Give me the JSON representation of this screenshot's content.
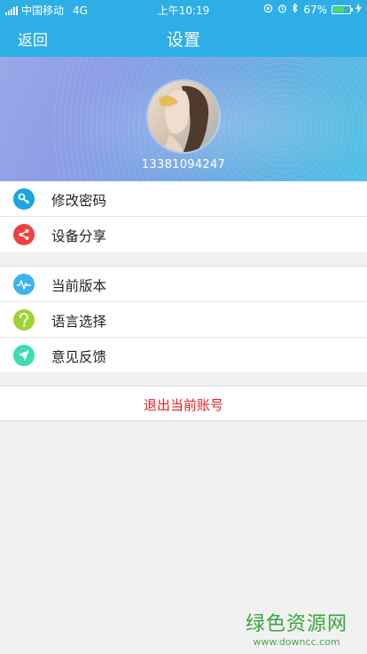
{
  "status_bar": {
    "carrier": "中国移动",
    "network": "4G",
    "time": "上午10:19",
    "battery_percent": "67%",
    "battery_level": 0.67
  },
  "navbar": {
    "back_label": "返回",
    "title": "设置"
  },
  "profile": {
    "phone": "13381094247"
  },
  "menu_group_1": [
    {
      "label": "修改密码",
      "icon": "key-icon",
      "color": "#17a6e0"
    },
    {
      "label": "设备分享",
      "icon": "share-icon",
      "color": "#f04040"
    }
  ],
  "menu_group_2": [
    {
      "label": "当前版本",
      "icon": "pulse-icon",
      "color": "#3db3ee"
    },
    {
      "label": "语言选择",
      "icon": "question-icon",
      "color": "#9ed431"
    },
    {
      "label": "意见反馈",
      "icon": "send-icon",
      "color": "#3cdcb4"
    }
  ],
  "logout": {
    "label": "退出当前账号",
    "color": "#e82020"
  },
  "watermark": {
    "title": "绿色资源网",
    "url": "www.downcc.com",
    "color": "#3aa63a"
  }
}
